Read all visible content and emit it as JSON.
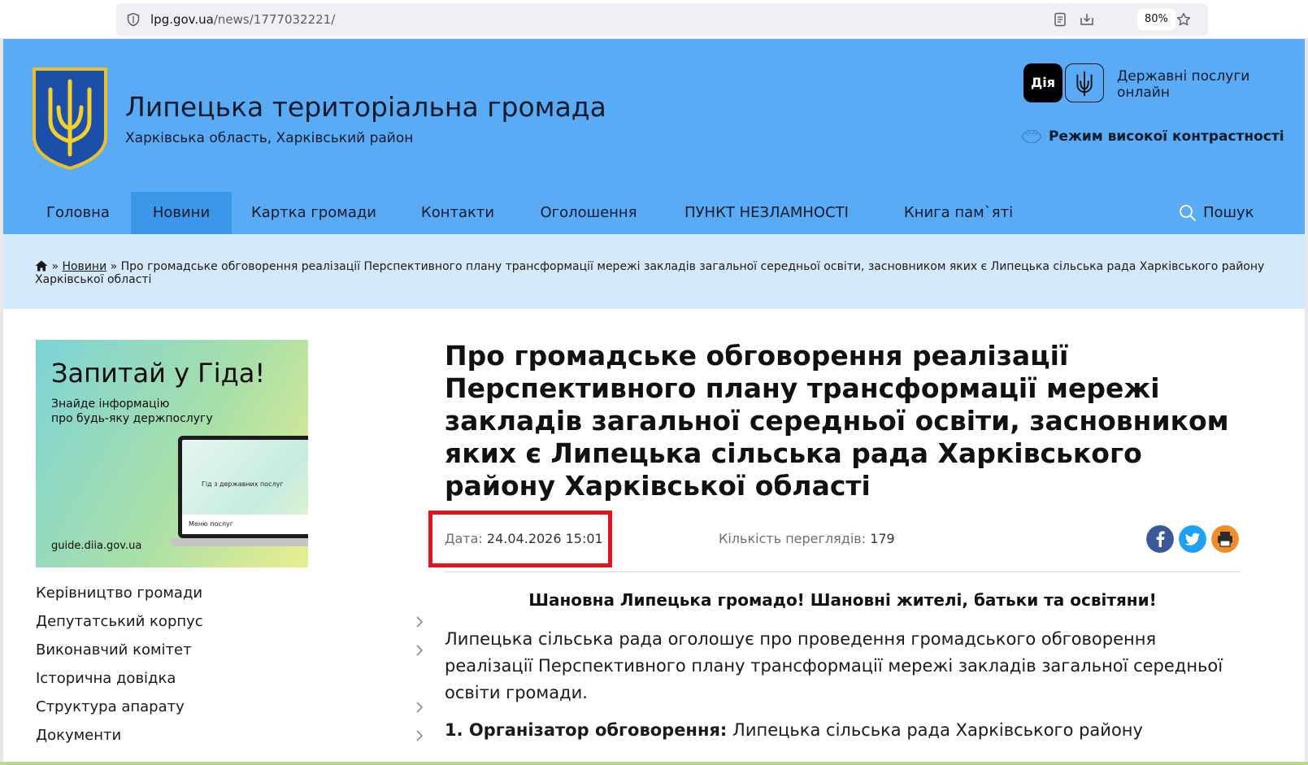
{
  "browser": {
    "url_host": "lpg.gov.ua",
    "url_path": "/news/1777032221/",
    "zoom": "80%"
  },
  "header": {
    "title": "Липецька територіальна громада",
    "subtitle": "Харківська область, Харківський район",
    "diia_badge": "Дія",
    "diia_text": "Державні послуги онлайн",
    "contrast_label": "Режим високої контрастності"
  },
  "nav": {
    "items": [
      {
        "label": "Головна"
      },
      {
        "label": "Новини"
      },
      {
        "label": "Картка громади"
      },
      {
        "label": "Контакти"
      },
      {
        "label": "Оголошення"
      },
      {
        "label": "ПУНКТ НЕЗЛАМНОСТІ"
      },
      {
        "label": "Книга пам`яті"
      }
    ],
    "active": "Новини",
    "search_label": "Пошук"
  },
  "breadcrumb": {
    "link": "Новини",
    "current": "Про громадське обговорення реалізації Перспективного плану трансформації мережі закладів загальної середньої освіти, засновником яких є Липецька сільська рада Харківського району Харківської області"
  },
  "banner": {
    "title": "Запитай у Гіда!",
    "subtitle_line1": "Знайде інформацію",
    "subtitle_line2": "про будь-яку держпослугу",
    "screen_title": "Гід з державних послуг",
    "screen_menu": "Меню послуг",
    "url": "guide.diia.gov.ua"
  },
  "sidemenu": {
    "items": [
      {
        "label": "Керівництво громади",
        "has_children": false
      },
      {
        "label": "Депутатський корпус",
        "has_children": true
      },
      {
        "label": "Виконавчий комітет",
        "has_children": true
      },
      {
        "label": "Історична довідка",
        "has_children": false
      },
      {
        "label": "Структура апарату",
        "has_children": true
      },
      {
        "label": "Документи",
        "has_children": true
      }
    ]
  },
  "article": {
    "title": "Про громадське обговорення реалізації Перспективного плану трансформації мережі закладів загальної середньої освіти, засновником яких є Липецька сільська рада Харківського району Харківської області",
    "date_label": "Дата:",
    "date_value": "24.04.2026 15:01",
    "views_label": "Кількість переглядів:",
    "views_value": "179",
    "greeting": "Шановна Липецька громадо! Шановні жителі, батьки та освітяни!",
    "lead": "Липецька сільська рада оголошує про проведення громадського обговорення реалізації Перспективного плану трансформації мережі закладів загальної середньої освіти громади.",
    "point1_label": "1. Організатор обговорення:",
    "point1_text": "Липецька сільська рада Харківського району"
  },
  "colors": {
    "header_bg": "#5aabf5",
    "nav_active": "#3d97e8",
    "breadcrumb_bg": "#d5e9fd",
    "highlight_box": "#e0141e",
    "facebook": "#3b5998",
    "twitter": "#1da1f2",
    "print": "#f28c28"
  },
  "icons": [
    "shield-icon",
    "reader-icon",
    "download-icon",
    "star-icon",
    "coat-of-arms-icon",
    "trident-icon",
    "eye-icon",
    "search-icon",
    "home-icon",
    "chevron-right-icon",
    "facebook-icon",
    "twitter-icon",
    "print-icon"
  ]
}
